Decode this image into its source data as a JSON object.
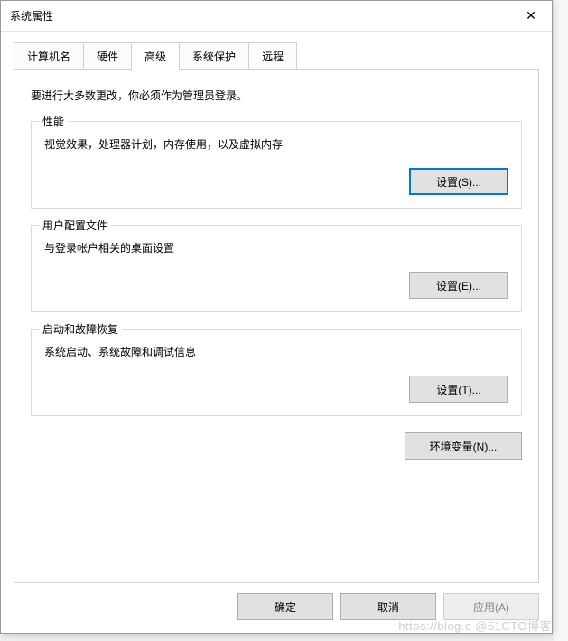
{
  "dialog": {
    "title": "系统属性",
    "tabs": [
      {
        "label": "计算机名",
        "active": false
      },
      {
        "label": "硬件",
        "active": false
      },
      {
        "label": "高级",
        "active": true
      },
      {
        "label": "系统保护",
        "active": false
      },
      {
        "label": "远程",
        "active": false
      }
    ],
    "instruction": "要进行大多数更改，你必须作为管理员登录。",
    "groups": {
      "performance": {
        "title": "性能",
        "desc": "视觉效果，处理器计划，内存使用，以及虚拟内存",
        "button": "设置(S)..."
      },
      "userProfiles": {
        "title": "用户配置文件",
        "desc": "与登录帐户相关的桌面设置",
        "button": "设置(E)..."
      },
      "startup": {
        "title": "启动和故障恢复",
        "desc": "系统启动、系统故障和调试信息",
        "button": "设置(T)..."
      }
    },
    "envButton": "环境变量(N)...",
    "footer": {
      "ok": "确定",
      "cancel": "取消",
      "apply": "应用(A)"
    }
  },
  "watermark": "https://blog.c @51CTO博客"
}
